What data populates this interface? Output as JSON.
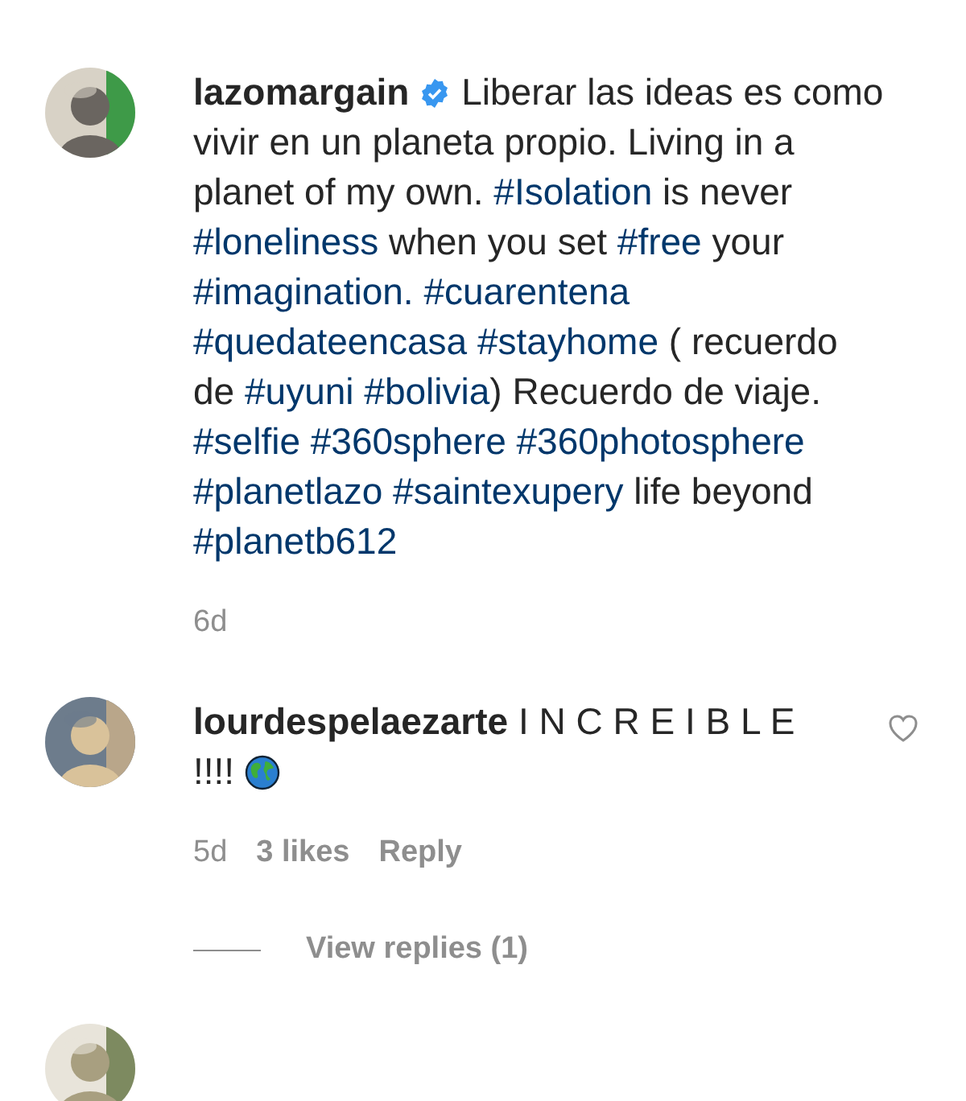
{
  "comments": [
    {
      "avatar": {
        "kind": "picture"
      },
      "username": "lazomargain",
      "verified": true,
      "segments": [
        {
          "kind": "text",
          "text": " Liberar las ideas es como vivir en un planeta propio. Living in a planet of my own. "
        },
        {
          "kind": "hashtag",
          "text": "#Isolation"
        },
        {
          "kind": "text",
          "text": " is never "
        },
        {
          "kind": "hashtag",
          "text": "#loneliness"
        },
        {
          "kind": "text",
          "text": " when you set "
        },
        {
          "kind": "hashtag",
          "text": "#free"
        },
        {
          "kind": "text",
          "text": " your "
        },
        {
          "kind": "hashtag",
          "text": "#imagination."
        },
        {
          "kind": "hashtag",
          "text": "#cuarentena"
        },
        {
          "kind": "hashtag",
          "text": "#quedateencasa"
        },
        {
          "kind": "hashtag",
          "text": "#stayhome"
        },
        {
          "kind": "text",
          "text": " ( recuerdo de "
        },
        {
          "kind": "hashtag",
          "text": "#uyuni"
        },
        {
          "kind": "hashtag",
          "text": "#bolivia"
        },
        {
          "kind": "text",
          "text": ") Recuerdo de viaje. "
        },
        {
          "kind": "hashtag",
          "text": "#selfie"
        },
        {
          "kind": "hashtag",
          "text": "#360sphere"
        },
        {
          "kind": "hashtag",
          "text": "#360photosphere"
        },
        {
          "kind": "hashtag",
          "text": "#planetlazo"
        },
        {
          "kind": "hashtag",
          "text": "#saintexupery"
        },
        {
          "kind": "text",
          "text": " life beyond "
        },
        {
          "kind": "hashtag",
          "text": "#planetb612"
        }
      ],
      "time": "6d"
    },
    {
      "avatar": {
        "kind": "picture"
      },
      "username": "lourdespelaezarte",
      "verified": false,
      "segments": [
        {
          "kind": "text",
          "text": " I N C R E I B L E !!!! "
        },
        {
          "kind": "emoji"
        }
      ],
      "time": "5d",
      "likes": "3 likes",
      "reply": "Reply",
      "like_button": {
        "liked": false
      },
      "view_replies": "View replies (1)"
    },
    {
      "avatar": {
        "kind": "picture"
      }
    }
  ]
}
